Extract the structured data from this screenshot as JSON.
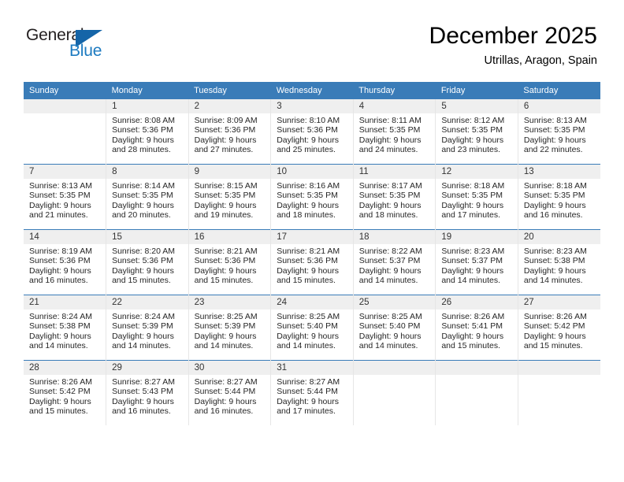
{
  "brand": {
    "name_part1": "General",
    "name_part2": "Blue",
    "logo_icon": "triangle-logo-icon",
    "blue": "#1c7ac0",
    "dark_blue": "#1565a8"
  },
  "header": {
    "month_title": "December 2025",
    "location": "Utrillas, Aragon, Spain"
  },
  "theme": {
    "header_row_bg": "#3a7cb8",
    "daynum_band_bg": "#efefef",
    "row_separator": "#3a7cb8"
  },
  "weekday_headers": [
    "Sunday",
    "Monday",
    "Tuesday",
    "Wednesday",
    "Thursday",
    "Friday",
    "Saturday"
  ],
  "weeks": [
    [
      {
        "day": "",
        "sunrise": "",
        "sunset": "",
        "daylight_line1": "",
        "daylight_line2": ""
      },
      {
        "day": "1",
        "sunrise": "Sunrise: 8:08 AM",
        "sunset": "Sunset: 5:36 PM",
        "daylight_line1": "Daylight: 9 hours",
        "daylight_line2": "and 28 minutes."
      },
      {
        "day": "2",
        "sunrise": "Sunrise: 8:09 AM",
        "sunset": "Sunset: 5:36 PM",
        "daylight_line1": "Daylight: 9 hours",
        "daylight_line2": "and 27 minutes."
      },
      {
        "day": "3",
        "sunrise": "Sunrise: 8:10 AM",
        "sunset": "Sunset: 5:36 PM",
        "daylight_line1": "Daylight: 9 hours",
        "daylight_line2": "and 25 minutes."
      },
      {
        "day": "4",
        "sunrise": "Sunrise: 8:11 AM",
        "sunset": "Sunset: 5:35 PM",
        "daylight_line1": "Daylight: 9 hours",
        "daylight_line2": "and 24 minutes."
      },
      {
        "day": "5",
        "sunrise": "Sunrise: 8:12 AM",
        "sunset": "Sunset: 5:35 PM",
        "daylight_line1": "Daylight: 9 hours",
        "daylight_line2": "and 23 minutes."
      },
      {
        "day": "6",
        "sunrise": "Sunrise: 8:13 AM",
        "sunset": "Sunset: 5:35 PM",
        "daylight_line1": "Daylight: 9 hours",
        "daylight_line2": "and 22 minutes."
      }
    ],
    [
      {
        "day": "7",
        "sunrise": "Sunrise: 8:13 AM",
        "sunset": "Sunset: 5:35 PM",
        "daylight_line1": "Daylight: 9 hours",
        "daylight_line2": "and 21 minutes."
      },
      {
        "day": "8",
        "sunrise": "Sunrise: 8:14 AM",
        "sunset": "Sunset: 5:35 PM",
        "daylight_line1": "Daylight: 9 hours",
        "daylight_line2": "and 20 minutes."
      },
      {
        "day": "9",
        "sunrise": "Sunrise: 8:15 AM",
        "sunset": "Sunset: 5:35 PM",
        "daylight_line1": "Daylight: 9 hours",
        "daylight_line2": "and 19 minutes."
      },
      {
        "day": "10",
        "sunrise": "Sunrise: 8:16 AM",
        "sunset": "Sunset: 5:35 PM",
        "daylight_line1": "Daylight: 9 hours",
        "daylight_line2": "and 18 minutes."
      },
      {
        "day": "11",
        "sunrise": "Sunrise: 8:17 AM",
        "sunset": "Sunset: 5:35 PM",
        "daylight_line1": "Daylight: 9 hours",
        "daylight_line2": "and 18 minutes."
      },
      {
        "day": "12",
        "sunrise": "Sunrise: 8:18 AM",
        "sunset": "Sunset: 5:35 PM",
        "daylight_line1": "Daylight: 9 hours",
        "daylight_line2": "and 17 minutes."
      },
      {
        "day": "13",
        "sunrise": "Sunrise: 8:18 AM",
        "sunset": "Sunset: 5:35 PM",
        "daylight_line1": "Daylight: 9 hours",
        "daylight_line2": "and 16 minutes."
      }
    ],
    [
      {
        "day": "14",
        "sunrise": "Sunrise: 8:19 AM",
        "sunset": "Sunset: 5:36 PM",
        "daylight_line1": "Daylight: 9 hours",
        "daylight_line2": "and 16 minutes."
      },
      {
        "day": "15",
        "sunrise": "Sunrise: 8:20 AM",
        "sunset": "Sunset: 5:36 PM",
        "daylight_line1": "Daylight: 9 hours",
        "daylight_line2": "and 15 minutes."
      },
      {
        "day": "16",
        "sunrise": "Sunrise: 8:21 AM",
        "sunset": "Sunset: 5:36 PM",
        "daylight_line1": "Daylight: 9 hours",
        "daylight_line2": "and 15 minutes."
      },
      {
        "day": "17",
        "sunrise": "Sunrise: 8:21 AM",
        "sunset": "Sunset: 5:36 PM",
        "daylight_line1": "Daylight: 9 hours",
        "daylight_line2": "and 15 minutes."
      },
      {
        "day": "18",
        "sunrise": "Sunrise: 8:22 AM",
        "sunset": "Sunset: 5:37 PM",
        "daylight_line1": "Daylight: 9 hours",
        "daylight_line2": "and 14 minutes."
      },
      {
        "day": "19",
        "sunrise": "Sunrise: 8:23 AM",
        "sunset": "Sunset: 5:37 PM",
        "daylight_line1": "Daylight: 9 hours",
        "daylight_line2": "and 14 minutes."
      },
      {
        "day": "20",
        "sunrise": "Sunrise: 8:23 AM",
        "sunset": "Sunset: 5:38 PM",
        "daylight_line1": "Daylight: 9 hours",
        "daylight_line2": "and 14 minutes."
      }
    ],
    [
      {
        "day": "21",
        "sunrise": "Sunrise: 8:24 AM",
        "sunset": "Sunset: 5:38 PM",
        "daylight_line1": "Daylight: 9 hours",
        "daylight_line2": "and 14 minutes."
      },
      {
        "day": "22",
        "sunrise": "Sunrise: 8:24 AM",
        "sunset": "Sunset: 5:39 PM",
        "daylight_line1": "Daylight: 9 hours",
        "daylight_line2": "and 14 minutes."
      },
      {
        "day": "23",
        "sunrise": "Sunrise: 8:25 AM",
        "sunset": "Sunset: 5:39 PM",
        "daylight_line1": "Daylight: 9 hours",
        "daylight_line2": "and 14 minutes."
      },
      {
        "day": "24",
        "sunrise": "Sunrise: 8:25 AM",
        "sunset": "Sunset: 5:40 PM",
        "daylight_line1": "Daylight: 9 hours",
        "daylight_line2": "and 14 minutes."
      },
      {
        "day": "25",
        "sunrise": "Sunrise: 8:25 AM",
        "sunset": "Sunset: 5:40 PM",
        "daylight_line1": "Daylight: 9 hours",
        "daylight_line2": "and 14 minutes."
      },
      {
        "day": "26",
        "sunrise": "Sunrise: 8:26 AM",
        "sunset": "Sunset: 5:41 PM",
        "daylight_line1": "Daylight: 9 hours",
        "daylight_line2": "and 15 minutes."
      },
      {
        "day": "27",
        "sunrise": "Sunrise: 8:26 AM",
        "sunset": "Sunset: 5:42 PM",
        "daylight_line1": "Daylight: 9 hours",
        "daylight_line2": "and 15 minutes."
      }
    ],
    [
      {
        "day": "28",
        "sunrise": "Sunrise: 8:26 AM",
        "sunset": "Sunset: 5:42 PM",
        "daylight_line1": "Daylight: 9 hours",
        "daylight_line2": "and 15 minutes."
      },
      {
        "day": "29",
        "sunrise": "Sunrise: 8:27 AM",
        "sunset": "Sunset: 5:43 PM",
        "daylight_line1": "Daylight: 9 hours",
        "daylight_line2": "and 16 minutes."
      },
      {
        "day": "30",
        "sunrise": "Sunrise: 8:27 AM",
        "sunset": "Sunset: 5:44 PM",
        "daylight_line1": "Daylight: 9 hours",
        "daylight_line2": "and 16 minutes."
      },
      {
        "day": "31",
        "sunrise": "Sunrise: 8:27 AM",
        "sunset": "Sunset: 5:44 PM",
        "daylight_line1": "Daylight: 9 hours",
        "daylight_line2": "and 17 minutes."
      },
      {
        "day": "",
        "sunrise": "",
        "sunset": "",
        "daylight_line1": "",
        "daylight_line2": ""
      },
      {
        "day": "",
        "sunrise": "",
        "sunset": "",
        "daylight_line1": "",
        "daylight_line2": ""
      },
      {
        "day": "",
        "sunrise": "",
        "sunset": "",
        "daylight_line1": "",
        "daylight_line2": ""
      }
    ]
  ]
}
